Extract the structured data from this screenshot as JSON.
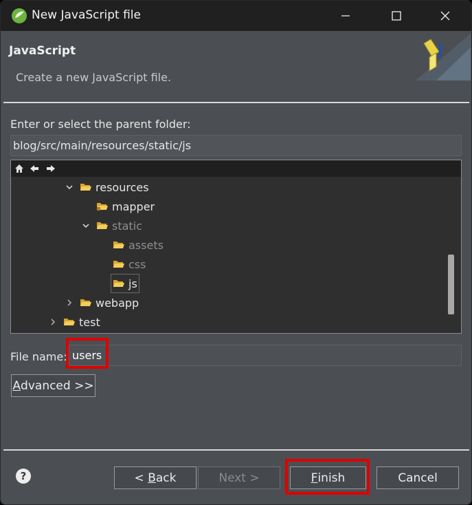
{
  "window": {
    "title": "New JavaScript file"
  },
  "header": {
    "title": "JavaScript",
    "description": "Create a new JavaScript file."
  },
  "parent_folder": {
    "label": "Enter or select the parent folder:",
    "value": "blog/src/main/resources/static/js"
  },
  "tree": {
    "items": [
      {
        "label": "resources",
        "state": "expanded"
      },
      {
        "label": "mapper",
        "state": "none"
      },
      {
        "label": "static",
        "state": "expanded"
      },
      {
        "label": "assets",
        "state": "none"
      },
      {
        "label": "css",
        "state": "none"
      },
      {
        "label": "js",
        "state": "selected"
      },
      {
        "label": "webapp",
        "state": "collapsed"
      },
      {
        "label": "test",
        "state": "collapsed"
      }
    ]
  },
  "file_name": {
    "label": "File name:",
    "value": "users"
  },
  "buttons": {
    "advanced_mnemonic": "A",
    "advanced_rest": "dvanced >>",
    "back_prefix": "< ",
    "back_mnemonic": "B",
    "back_rest": "ack",
    "next": "Next >",
    "finish_mnemonic": "F",
    "finish_rest": "inish",
    "cancel": "Cancel"
  },
  "colors": {
    "highlight": "#e00000",
    "folder": "#f0c040"
  }
}
